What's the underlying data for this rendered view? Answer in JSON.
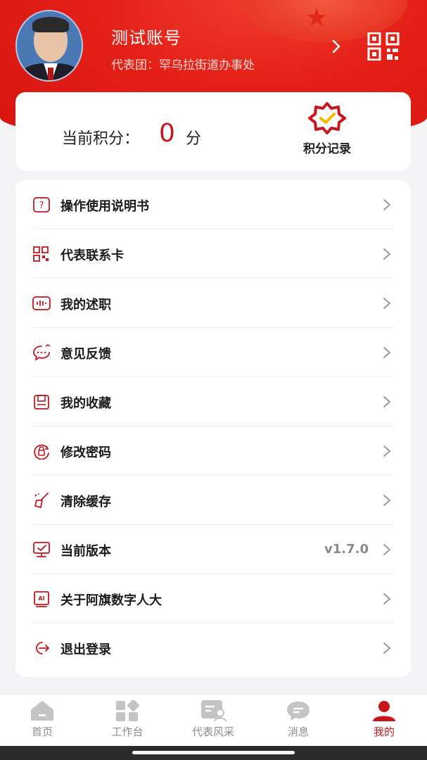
{
  "profile": {
    "name": "测试账号",
    "delegation": "代表团：罕乌拉街道办事处"
  },
  "points": {
    "label": "当前积分：",
    "value": "0",
    "unit": "分",
    "record_label": "积分记录"
  },
  "menu": [
    {
      "label": "操作使用说明书",
      "icon": "manual-icon",
      "value": ""
    },
    {
      "label": "代表联系卡",
      "icon": "contact-card-icon",
      "value": ""
    },
    {
      "label": "我的述职",
      "icon": "voice-report-icon",
      "value": ""
    },
    {
      "label": "意见反馈",
      "icon": "feedback-icon",
      "value": ""
    },
    {
      "label": "我的收藏",
      "icon": "favorites-icon",
      "value": ""
    },
    {
      "label": "修改密码",
      "icon": "password-icon",
      "value": ""
    },
    {
      "label": "清除缓存",
      "icon": "clear-cache-icon",
      "value": ""
    },
    {
      "label": "当前版本",
      "icon": "version-icon",
      "value": "v1.7.0"
    },
    {
      "label": "关于阿旗数字人大",
      "icon": "about-ai-icon",
      "value": ""
    },
    {
      "label": "退出登录",
      "icon": "logout-icon",
      "value": ""
    }
  ],
  "tabs": [
    {
      "label": "首页",
      "icon": "home-icon"
    },
    {
      "label": "工作台",
      "icon": "workbench-icon"
    },
    {
      "label": "代表风采",
      "icon": "representative-icon"
    },
    {
      "label": "消息",
      "icon": "message-icon"
    },
    {
      "label": "我的",
      "icon": "profile-icon",
      "active": true
    }
  ],
  "colors": {
    "brand_red": "#c8161d",
    "hero_red": "#e41f17",
    "tab_inactive": "#8d8d8d"
  }
}
